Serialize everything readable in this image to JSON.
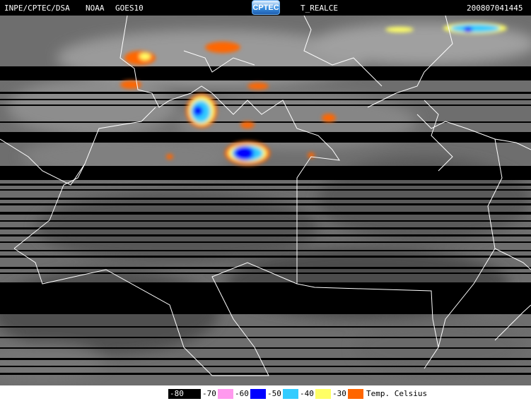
{
  "header": {
    "source": "INPE/CPTEC/DSA",
    "agency": "NOAA",
    "satellite": "GOES10",
    "logo": "CPTEC",
    "product": "T_REALCE",
    "timestamp": "200807041445"
  },
  "legend": {
    "unit_label": "Temp. Celsius",
    "entries": [
      {
        "label": "-80",
        "color": "#000000"
      },
      {
        "label": "-70",
        "color": "#ff99ee"
      },
      {
        "label": "-60",
        "color": "#0000ff"
      },
      {
        "label": "-50",
        "color": "#33ccff"
      },
      {
        "label": "-40",
        "color": "#ffff66"
      },
      {
        "label": "-30",
        "color": "#ff6600"
      }
    ]
  },
  "colors": {
    "background": "#000000",
    "borders": "#ffffff",
    "cloud_gray": "#8a8a8a"
  }
}
